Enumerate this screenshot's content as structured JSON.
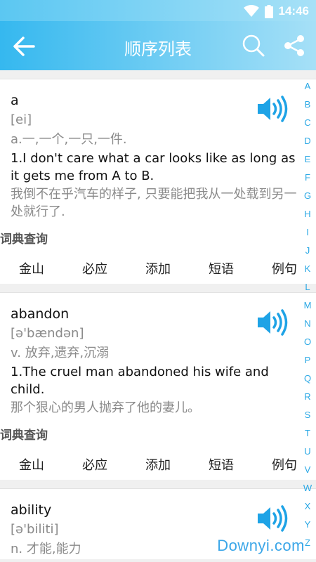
{
  "status": {
    "time": "14:46",
    "wifi_icon": "wifi-icon",
    "battery_icon": "battery-icon"
  },
  "appbar": {
    "title": "顺序列表",
    "back_icon": "back-arrow-icon",
    "search_icon": "search-icon",
    "share_icon": "share-icon"
  },
  "entries": [
    {
      "word": "a",
      "phonetic": "[ei]",
      "definition": "a.一,一个,一只,一件.",
      "example_en": "1.I don't care what a car looks like as long as it gets me from A to B.",
      "example_zh": "我倒不在乎汽车的样子, 只要能把我从一处载到另一处就行了.",
      "dict_label": "词典查询",
      "links": [
        "金山",
        "必应",
        "添加",
        "短语",
        "例句"
      ]
    },
    {
      "word": "abandon",
      "phonetic": "[ə'bændən]",
      "definition": "v. 放弃,遗弃,沉溺",
      "example_en": "1.The cruel man abandoned his wife and child.",
      "example_zh": "那个狠心的男人抛弃了他的妻儿。",
      "dict_label": "词典查询",
      "links": [
        "金山",
        "必应",
        "添加",
        "短语",
        "例句"
      ]
    },
    {
      "word": "ability",
      "phonetic": "[ə'biliti]",
      "definition": "n. 才能,能力"
    }
  ],
  "alphabet": [
    "A",
    "B",
    "C",
    "D",
    "E",
    "F",
    "G",
    "H",
    "I",
    "J",
    "K",
    "L",
    "M",
    "N",
    "O",
    "P",
    "Q",
    "R",
    "S",
    "T",
    "U",
    "V",
    "W",
    "X",
    "Y",
    "Z"
  ],
  "watermark": "Downyi.com",
  "colors": {
    "accent": "#2aa8e5",
    "appbar_start": "#35b8ef",
    "appbar_end": "#a6e0f7"
  }
}
